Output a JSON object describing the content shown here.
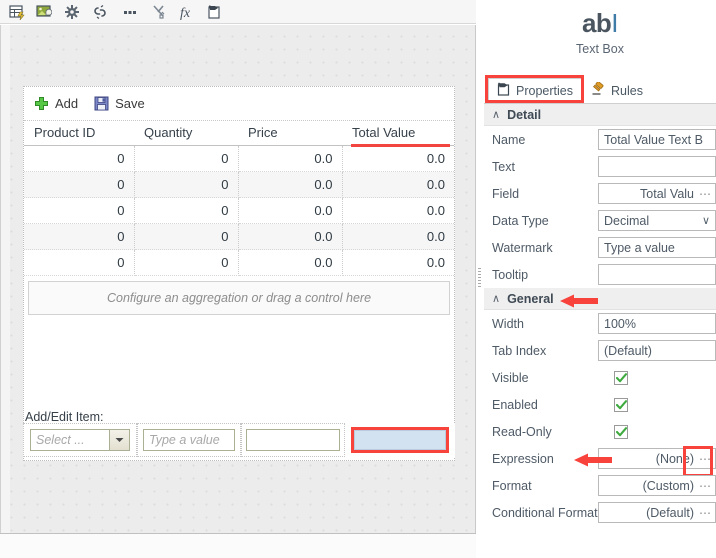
{
  "toolbar": {
    "buttons": [
      {
        "name": "insert-table-icon",
        "title": "Insert Table"
      },
      {
        "name": "insert-image-icon",
        "title": "Insert Image"
      },
      {
        "name": "settings-gear-icon",
        "title": "Settings"
      },
      {
        "name": "broken-link-icon",
        "title": "Unlink"
      },
      {
        "name": "more-options-icon",
        "title": "More"
      },
      {
        "name": "cut-swap-icon",
        "title": "Swap"
      },
      {
        "name": "function-fx-icon",
        "title": "Function"
      },
      {
        "name": "paste-clipboard-icon",
        "title": "Paste"
      }
    ]
  },
  "grid": {
    "add_label": "Add",
    "save_label": "Save",
    "columns": [
      "Product ID",
      "Quantity",
      "Price",
      "Total Value"
    ],
    "highlighted_column": "Total Value",
    "rows": [
      [
        "0",
        "0",
        "0.0",
        "0.0"
      ],
      [
        "0",
        "0",
        "0.0",
        "0.0"
      ],
      [
        "0",
        "0",
        "0.0",
        "0.0"
      ],
      [
        "0",
        "0",
        "0.0",
        "0.0"
      ],
      [
        "0",
        "0",
        "0.0",
        "0.0"
      ]
    ],
    "aggregation_placeholder": "Configure an aggregation or drag a control here"
  },
  "add_edit": {
    "label": "Add/Edit Item:",
    "select_placeholder": "Select ...",
    "value_placeholder": "Type a value",
    "third_value": "",
    "fourth_value": ""
  },
  "properties_panel": {
    "control_icon": "ab",
    "control_icon_caret": "I",
    "control_title": "Text Box",
    "tabs": [
      {
        "label": "Properties",
        "icon": "properties-icon",
        "active": true,
        "highlighted": true
      },
      {
        "label": "Rules",
        "icon": "gavel-icon",
        "active": false,
        "highlighted": false
      }
    ],
    "sections": [
      {
        "name": "Detail",
        "caret": "∧",
        "rows": [
          {
            "label": "Name",
            "value": "Total Value Text B",
            "type": "text"
          },
          {
            "label": "Text",
            "value": "",
            "type": "text"
          },
          {
            "label": "Field",
            "value": "Total Valu",
            "type": "ellipsis",
            "ellipsis": "⋯"
          },
          {
            "label": "Data Type",
            "value": "Decimal",
            "type": "select",
            "chevron": "∨"
          },
          {
            "label": "Watermark",
            "value": "Type a value",
            "type": "text"
          },
          {
            "label": "Tooltip",
            "value": "",
            "type": "text"
          }
        ]
      },
      {
        "name": "General",
        "caret": "∧",
        "arrow": true,
        "rows": [
          {
            "label": "Width",
            "value": "100%",
            "type": "text"
          },
          {
            "label": "Tab Index",
            "value": "(Default)",
            "type": "text"
          },
          {
            "label": "Visible",
            "value": "",
            "type": "checkbox",
            "checked": true
          },
          {
            "label": "Enabled",
            "value": "",
            "type": "checkbox",
            "checked": true
          },
          {
            "label": "Read-Only",
            "value": "",
            "type": "checkbox",
            "checked": true
          },
          {
            "label": "Expression",
            "value": "(None)",
            "type": "ellipsis",
            "ellipsis": "⋯",
            "arrow": true,
            "highlight_button": true
          },
          {
            "label": "Format",
            "value": "(Custom)",
            "type": "ellipsis",
            "ellipsis": "⋯"
          },
          {
            "label": "Conditional Format",
            "value": "(Default)",
            "type": "ellipsis",
            "ellipsis": "⋯"
          }
        ]
      }
    ]
  },
  "colors": {
    "highlight_red": "#f8423c",
    "selected_field_fill": "#d3e2f0",
    "check_green": "#3faa3f",
    "panel_section_bg": "#efefef",
    "canvas_bg": "#ececec"
  }
}
